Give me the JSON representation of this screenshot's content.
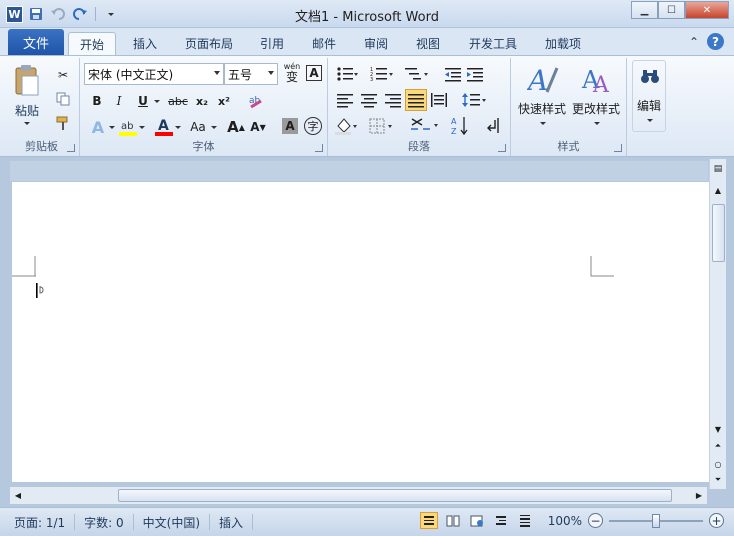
{
  "window": {
    "title": "文档1  -  Microsoft Word",
    "app_logo": "W"
  },
  "tabs": {
    "file": "文件",
    "items": [
      "开始",
      "插入",
      "页面布局",
      "引用",
      "邮件",
      "审阅",
      "视图",
      "开发工具",
      "加载项"
    ],
    "active": "开始"
  },
  "ribbon": {
    "clipboard": {
      "paste": "粘贴",
      "label": "剪贴板"
    },
    "font": {
      "font_name": "宋体 (中文正文)",
      "font_size": "五号",
      "phonetic": "wén",
      "label": "字体",
      "bold": "B",
      "italic": "I",
      "underline": "U",
      "strike": "abc",
      "subscript": "x₂",
      "superscript": "x²",
      "change_case": "Aa",
      "grow": "A",
      "shrink": "A",
      "char_shade": "A",
      "enclose": "字"
    },
    "paragraph": {
      "label": "段落"
    },
    "styles": {
      "quick_styles": "快速样式",
      "change_styles": "更改样式",
      "label": "样式"
    },
    "editing": {
      "label": "编辑"
    }
  },
  "status": {
    "page": "页面: 1/1",
    "words": "字数: 0",
    "language": "中文(中国)",
    "insert_mode": "插入",
    "zoom": "100%"
  },
  "colors": {
    "accent": "#2b5797",
    "highlight": "#ffff00",
    "font_color": "#ff0000"
  }
}
